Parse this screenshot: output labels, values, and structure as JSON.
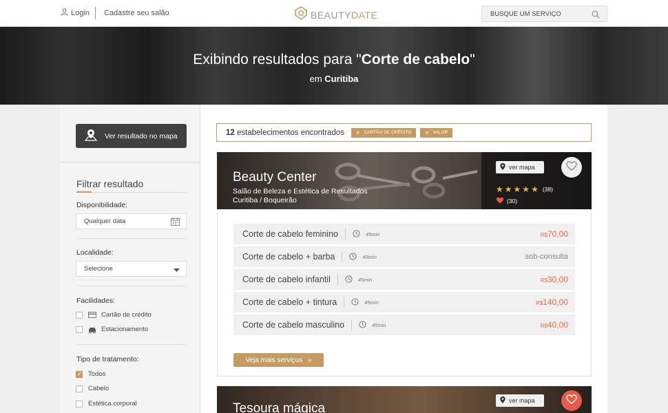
{
  "header": {
    "login_label": "Login",
    "register_label": "Cadastre seu salão",
    "logo_part1": "BEAUTY",
    "logo_part2": "DATE",
    "search_placeholder": "BUSQUE UM SERVIÇO"
  },
  "hero": {
    "title_prefix": "Exibindo resultados para \"",
    "query": "Corte de cabelo",
    "title_suffix": "\"",
    "subtitle_prefix": "em ",
    "city": "Curitiba"
  },
  "sidebar": {
    "map_button_label": "Ver resultado no mapa",
    "filter_title": "Filtrar resultado",
    "availability_label": "Disponibilidade:",
    "availability_value": "Qualquer data",
    "location_label": "Localidade:",
    "location_value": "Selecione",
    "facilities_label": "Facilidades:",
    "facilities": [
      {
        "label": "Cartão de crédito",
        "icon": "credit-card-icon",
        "checked": false
      },
      {
        "label": "Estacionamento",
        "icon": "car-icon",
        "checked": false
      }
    ],
    "treatment_label": "Tipo de tratamento:",
    "treatments": [
      {
        "label": "Todos",
        "checked": true
      },
      {
        "label": "Cabelo",
        "checked": false
      },
      {
        "label": "Estética corporal",
        "checked": false
      }
    ]
  },
  "results": {
    "count": "12",
    "count_label": "estabelecimentos encontrados",
    "chips": [
      "Cartão de crédito",
      "Valor"
    ]
  },
  "salons": [
    {
      "name": "Beauty Center",
      "description": "Salão de Beleza e Estética de Resultados",
      "location": "Curitiba / Boqueirão",
      "map_label": "ver mapa",
      "rating_count": "(38)",
      "favorites_count": "(30)",
      "favorited": false,
      "services": [
        {
          "name": "Corte de cabelo feminino",
          "time": "45min",
          "currency": "R$",
          "price": "70,00"
        },
        {
          "name": "Corte de cabelo + barba",
          "time": "45min",
          "currency": "",
          "price": "sob-consulta"
        },
        {
          "name": "Corte de cabelo infantil",
          "time": "45min",
          "currency": "R$",
          "price": "30,00"
        },
        {
          "name": "Corte de cabelo + tintura",
          "time": "45min",
          "currency": "R$",
          "price": "140,00"
        },
        {
          "name": "Corte de cabelo masculino",
          "time": "45min",
          "currency": "R$",
          "price": "40,00"
        }
      ],
      "more_label": "Veja mais serviços"
    },
    {
      "name": "Tesoura mágica",
      "map_label": "ver mapa",
      "favorited": true
    }
  ],
  "colors": {
    "accent": "#c59b64",
    "price": "#e86a4a",
    "favorite": "#e85a4a"
  }
}
